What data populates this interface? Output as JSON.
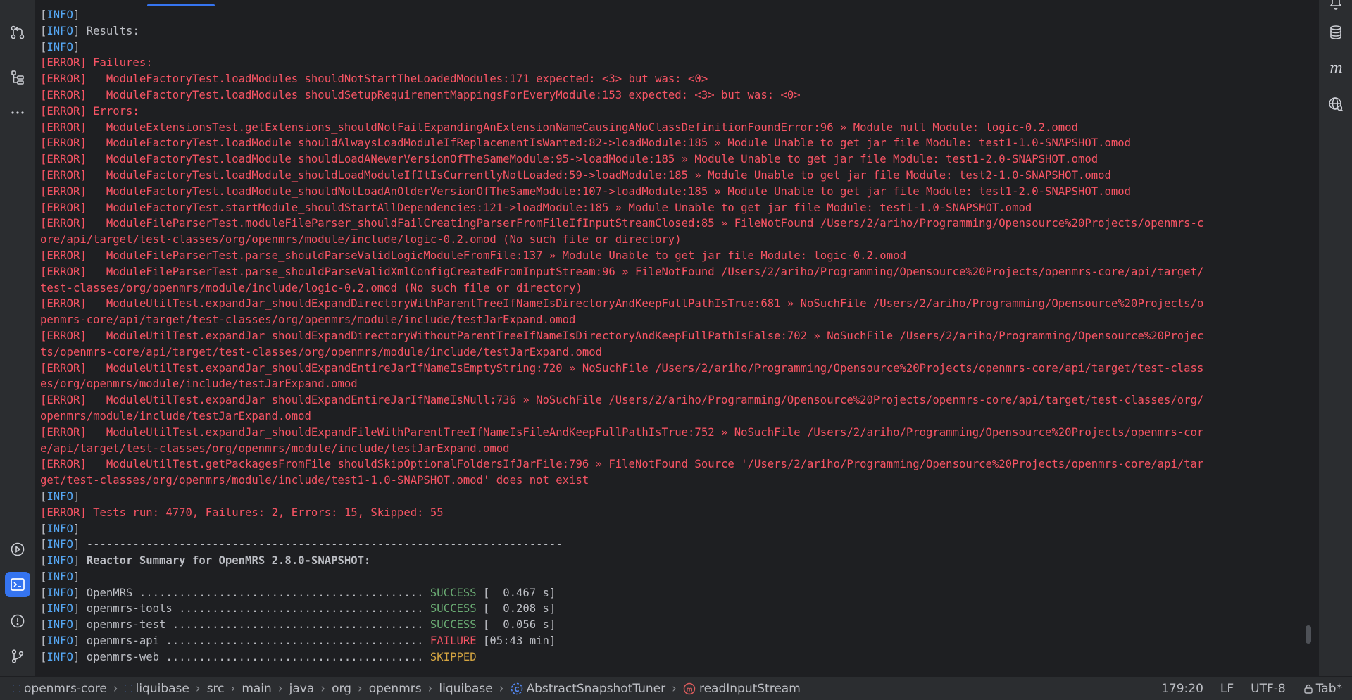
{
  "console": {
    "lines": [
      [
        {
          "t": "[",
          "c": "bk"
        },
        {
          "t": "INFO",
          "c": "lvl-info"
        },
        {
          "t": "]",
          "c": "bk"
        }
      ],
      [
        {
          "t": "[",
          "c": "bk"
        },
        {
          "t": "INFO",
          "c": "lvl-info"
        },
        {
          "t": "] Results:",
          "c": "bk"
        }
      ],
      [
        {
          "t": "[",
          "c": "bk"
        },
        {
          "t": "INFO",
          "c": "lvl-info"
        },
        {
          "t": "]",
          "c": "bk"
        }
      ],
      [
        {
          "t": "[ERROR] Failures:",
          "c": "err"
        }
      ],
      [
        {
          "t": "[ERROR]   ModuleFactoryTest.loadModules_shouldNotStartTheLoadedModules:171 expected: <3> but was: <0>",
          "c": "err"
        }
      ],
      [
        {
          "t": "[ERROR]   ModuleFactoryTest.loadModules_shouldSetupRequirementMappingsForEveryModule:153 expected: <3> but was: <0>",
          "c": "err"
        }
      ],
      [
        {
          "t": "[ERROR] Errors:",
          "c": "err"
        }
      ],
      [
        {
          "t": "[ERROR]   ModuleExtensionsTest.getExtensions_shouldNotFailExpandingAnExtensionNameCausingANoClassDefinitionFoundError:96 » Module null Module: logic-0.2.omod",
          "c": "err"
        }
      ],
      [
        {
          "t": "[ERROR]   ModuleFactoryTest.loadModule_shouldAlwaysLoadModuleIfReplacementIsWanted:82->loadModule:185 » Module Unable to get jar file Module: test1-1.0-SNAPSHOT.omod",
          "c": "err"
        }
      ],
      [
        {
          "t": "[ERROR]   ModuleFactoryTest.loadModule_shouldLoadANewerVersionOfTheSameModule:95->loadModule:185 » Module Unable to get jar file Module: test1-2.0-SNAPSHOT.omod",
          "c": "err"
        }
      ],
      [
        {
          "t": "[ERROR]   ModuleFactoryTest.loadModule_shouldLoadModuleIfItIsCurrentlyNotLoaded:59->loadModule:185 » Module Unable to get jar file Module: test2-1.0-SNAPSHOT.omod",
          "c": "err"
        }
      ],
      [
        {
          "t": "[ERROR]   ModuleFactoryTest.loadModule_shouldNotLoadAnOlderVersionOfTheSameModule:107->loadModule:185 » Module Unable to get jar file Module: test1-2.0-SNAPSHOT.omod",
          "c": "err"
        }
      ],
      [
        {
          "t": "[ERROR]   ModuleFactoryTest.startModule_shouldStartAllDependencies:121->loadModule:185 » Module Unable to get jar file Module: test1-1.0-SNAPSHOT.omod",
          "c": "err"
        }
      ],
      [
        {
          "t": "[ERROR]   ModuleFileParserTest.moduleFileParser_shouldFailCreatingParserFromFileIfInputStreamClosed:85 » FileNotFound /Users/2/ariho/Programming/Opensource%20Projects/openmrs-c",
          "c": "err"
        }
      ],
      [
        {
          "t": "ore/api/target/test-classes/org/openmrs/module/include/logic-0.2.omod (No such file or directory)",
          "c": "err"
        }
      ],
      [
        {
          "t": "[ERROR]   ModuleFileParserTest.parse_shouldParseValidLogicModuleFromFile:137 » Module Unable to get jar file Module: logic-0.2.omod",
          "c": "err"
        }
      ],
      [
        {
          "t": "[ERROR]   ModuleFileParserTest.parse_shouldParseValidXmlConfigCreatedFromInputStream:96 » FileNotFound /Users/2/ariho/Programming/Opensource%20Projects/openmrs-core/api/target/",
          "c": "err"
        }
      ],
      [
        {
          "t": "test-classes/org/openmrs/module/include/logic-0.2.omod (No such file or directory)",
          "c": "err"
        }
      ],
      [
        {
          "t": "[ERROR]   ModuleUtilTest.expandJar_shouldExpandDirectoryWithParentTreeIfNameIsDirectoryAndKeepFullPathIsTrue:681 » NoSuchFile /Users/2/ariho/Programming/Opensource%20Projects/o",
          "c": "err"
        }
      ],
      [
        {
          "t": "penmrs-core/api/target/test-classes/org/openmrs/module/include/testJarExpand.omod",
          "c": "err"
        }
      ],
      [
        {
          "t": "[ERROR]   ModuleUtilTest.expandJar_shouldExpandDirectoryWithoutParentTreeIfNameIsDirectoryAndKeepFullPathIsFalse:702 » NoSuchFile /Users/2/ariho/Programming/Opensource%20Projec",
          "c": "err"
        }
      ],
      [
        {
          "t": "ts/openmrs-core/api/target/test-classes/org/openmrs/module/include/testJarExpand.omod",
          "c": "err"
        }
      ],
      [
        {
          "t": "[ERROR]   ModuleUtilTest.expandJar_shouldExpandEntireJarIfNameIsEmptyString:720 » NoSuchFile /Users/2/ariho/Programming/Opensource%20Projects/openmrs-core/api/target/test-class",
          "c": "err"
        }
      ],
      [
        {
          "t": "es/org/openmrs/module/include/testJarExpand.omod",
          "c": "err"
        }
      ],
      [
        {
          "t": "[ERROR]   ModuleUtilTest.expandJar_shouldExpandEntireJarIfNameIsNull:736 » NoSuchFile /Users/2/ariho/Programming/Opensource%20Projects/openmrs-core/api/target/test-classes/org/",
          "c": "err"
        }
      ],
      [
        {
          "t": "openmrs/module/include/testJarExpand.omod",
          "c": "err"
        }
      ],
      [
        {
          "t": "[ERROR]   ModuleUtilTest.expandJar_shouldExpandFileWithParentTreeIfNameIsFileAndKeepFullPathIsTrue:752 » NoSuchFile /Users/2/ariho/Programming/Opensource%20Projects/openmrs-cor",
          "c": "err"
        }
      ],
      [
        {
          "t": "e/api/target/test-classes/org/openmrs/module/include/testJarExpand.omod",
          "c": "err"
        }
      ],
      [
        {
          "t": "[ERROR]   ModuleUtilTest.getPackagesFromFile_shouldSkipOptionalFoldersIfJarFile:796 » FileNotFound Source '/Users/2/ariho/Programming/Opensource%20Projects/openmrs-core/api/tar",
          "c": "err"
        }
      ],
      [
        {
          "t": "get/test-classes/org/openmrs/module/include/test1-1.0-SNAPSHOT.omod' does not exist",
          "c": "err"
        }
      ],
      [
        {
          "t": "[",
          "c": "bk"
        },
        {
          "t": "INFO",
          "c": "lvl-info"
        },
        {
          "t": "]",
          "c": "bk"
        }
      ],
      [
        {
          "t": "[ERROR] Tests run: 4770, Failures: 2, Errors: 15, Skipped: 55",
          "c": "err"
        }
      ],
      [
        {
          "t": "[",
          "c": "bk"
        },
        {
          "t": "INFO",
          "c": "lvl-info"
        },
        {
          "t": "]",
          "c": "bk"
        }
      ],
      [
        {
          "t": "[",
          "c": "bk"
        },
        {
          "t": "INFO",
          "c": "lvl-info"
        },
        {
          "t": "] ------------------------------------------------------------------------",
          "c": "bk"
        }
      ],
      [
        {
          "t": "[",
          "c": "bk"
        },
        {
          "t": "INFO",
          "c": "lvl-info"
        },
        {
          "t": "] ",
          "c": "bk"
        },
        {
          "t": "Reactor Summary for OpenMRS 2.8.0-SNAPSHOT:",
          "c": "bk bold"
        }
      ],
      [
        {
          "t": "[",
          "c": "bk"
        },
        {
          "t": "INFO",
          "c": "lvl-info"
        },
        {
          "t": "]",
          "c": "bk"
        }
      ],
      [
        {
          "t": "[",
          "c": "bk"
        },
        {
          "t": "INFO",
          "c": "lvl-info"
        },
        {
          "t": "] OpenMRS ........................................... ",
          "c": "bk"
        },
        {
          "t": "SUCCESS",
          "c": "ok"
        },
        {
          "t": " [  0.467 s]",
          "c": "bk"
        }
      ],
      [
        {
          "t": "[",
          "c": "bk"
        },
        {
          "t": "INFO",
          "c": "lvl-info"
        },
        {
          "t": "] openmrs-tools ..................................... ",
          "c": "bk"
        },
        {
          "t": "SUCCESS",
          "c": "ok"
        },
        {
          "t": " [  0.208 s]",
          "c": "bk"
        }
      ],
      [
        {
          "t": "[",
          "c": "bk"
        },
        {
          "t": "INFO",
          "c": "lvl-info"
        },
        {
          "t": "] openmrs-test ...................................... ",
          "c": "bk"
        },
        {
          "t": "SUCCESS",
          "c": "ok"
        },
        {
          "t": " [  0.056 s]",
          "c": "bk"
        }
      ],
      [
        {
          "t": "[",
          "c": "bk"
        },
        {
          "t": "INFO",
          "c": "lvl-info"
        },
        {
          "t": "] openmrs-api ....................................... ",
          "c": "bk"
        },
        {
          "t": "FAILURE",
          "c": "err"
        },
        {
          "t": " [05:43 min]",
          "c": "bk"
        }
      ],
      [
        {
          "t": "[",
          "c": "bk"
        },
        {
          "t": "INFO",
          "c": "lvl-info"
        },
        {
          "t": "] openmrs-web ....................................... ",
          "c": "bk"
        },
        {
          "t": "SKIPPED",
          "c": "skip"
        }
      ]
    ]
  },
  "statusbar": {
    "crumbs": [
      "openmrs-core",
      "liquibase",
      "src",
      "main",
      "java",
      "org",
      "openmrs",
      "liquibase",
      "AbstractSnapshotTuner",
      "readInputStream"
    ],
    "position": "179:20",
    "line_ending": "LF",
    "encoding": "UTF-8",
    "indent": "Tab*"
  },
  "icons": {
    "left": [
      "git-commit-icon",
      "structure-icon",
      "more-icon",
      "services-icon",
      "terminal-icon",
      "problems-icon",
      "git-branch-icon"
    ],
    "right": [
      "notifications-icon",
      "database-icon",
      "maven-icon",
      "endpoints-icon"
    ]
  },
  "colors": {
    "info": "#56a8f5",
    "error": "#f75464",
    "success": "#6aab73",
    "skipped": "#d5a541",
    "accent": "#3574f0"
  }
}
